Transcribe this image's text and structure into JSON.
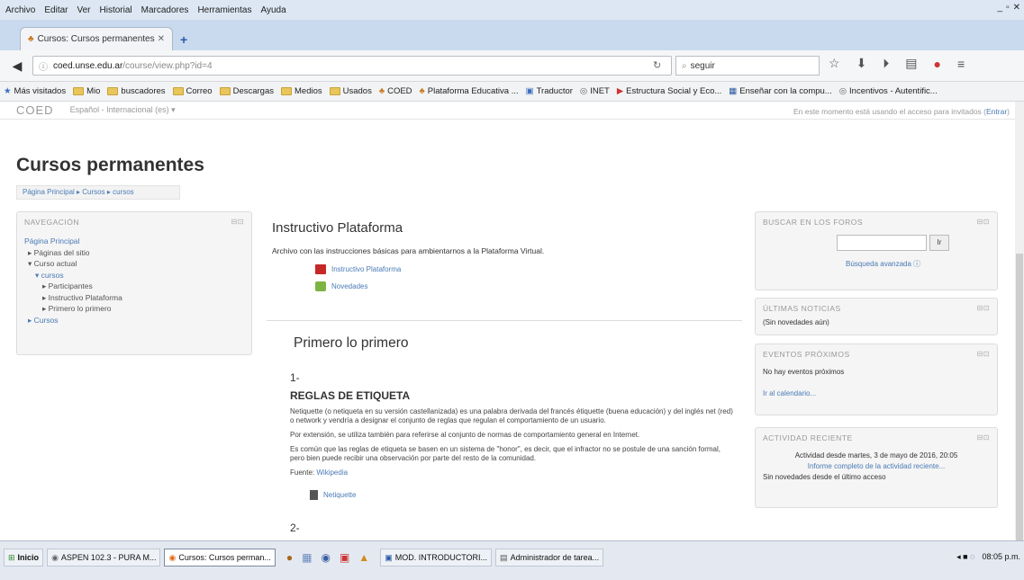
{
  "browser": {
    "menu": [
      "Archivo",
      "Editar",
      "Ver",
      "Historial",
      "Marcadores",
      "Herramientas",
      "Ayuda"
    ],
    "tab_title": "Cursos: Cursos permanentes",
    "url_domain": "coed.unse.edu.ar",
    "url_rest": "/course/view.php?id=4",
    "search_text": "seguir",
    "bookmarks": [
      "Más visitados",
      "Mio",
      "buscadores",
      "Correo",
      "Descargas",
      "Medios",
      "Usados",
      "COED",
      "Plataforma Educativa ...",
      "Traductor",
      "INET",
      "Estructura Social y Eco...",
      "Enseñar con la compu...",
      "Incentivos - Autentific..."
    ]
  },
  "moodle": {
    "logo": "COED",
    "language": "Español - Internacional (es) ▾",
    "login_prefix": "En este momento está usando el acceso para invitados (",
    "login_link": "Entrar",
    "login_suffix": ")",
    "page_title": "Cursos permanentes",
    "breadcrumb": "Página Principal ▸ Cursos ▸ cursos"
  },
  "navigation": {
    "header": "NAVEGACIÓN",
    "items": [
      "Página Principal",
      "▸ Páginas del sitio",
      "▾ Curso actual",
      "▾ cursos",
      "▸ Participantes",
      "▸ Instructivo Plataforma",
      "▸ Primero lo primero",
      "▸ Cursos"
    ]
  },
  "main": {
    "section1_title": "Instructivo Plataforma",
    "section1_desc": "Archivo con las instrucciones básicas para ambientarnos a la Plataforma Virtual.",
    "resource1": "Instructivo Plataforma",
    "resource2": "Novedades",
    "section2_title": "Primero lo primero",
    "item_number": "1-",
    "heading": "REGLAS DE ETIQUETA",
    "para1": "Netiquette (o netiqueta en su versión castellanizada) es una palabra derivada del francés étiquette (buena educación) y del inglés net (red) o network y vendría a designar el conjunto de reglas que regulan el comportamiento de un usuario.",
    "para2": "Por extensión, se utiliza también para referirse al conjunto de normas de comportamiento general en Internet.",
    "para3": "Es común que las reglas de etiqueta se basen en un sistema de \"honor\", es decir, que el infractor no se postule de una sanción formal, pero bien puede recibir una observación por parte del resto de la comunidad.",
    "source_label": "Fuente:",
    "source_link": "Wikipedia",
    "resource3": "Netiquette",
    "item_number2": "2-"
  },
  "right": {
    "search_forum_header": "BUSCAR EN LOS FOROS",
    "search_button": "Ir",
    "advanced_search": "Búsqueda avanzada ⓘ",
    "news_header": "ÚLTIMAS NOTICIAS",
    "news_text": "(Sin novedades aún)",
    "events_header": "EVENTOS PRÓXIMOS",
    "events_text": "No hay eventos próximos",
    "calendar_link": "Ir al calendario...",
    "recent_header": "ACTIVIDAD RECIENTE",
    "recent_text1": "Actividad desde martes, 3 de mayo de 2016, 20:05",
    "recent_link": "Informe completo de la actividad reciente...",
    "recent_text2": "Sin novedades desde el último acceso"
  },
  "taskbar": {
    "start": "Inicio",
    "items": [
      "ASPEN 102.3 - PURA M...",
      "Cursos: Cursos perman...",
      "MOD. INTRODUCTORI...",
      "Administrador de tarea..."
    ],
    "clock": "08:05 p.m."
  }
}
